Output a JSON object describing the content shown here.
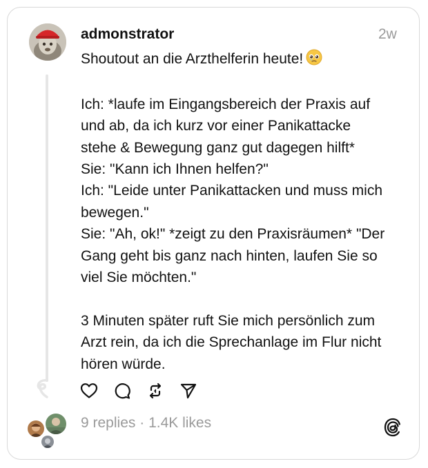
{
  "post": {
    "username": "admonstrator",
    "timestamp": "2w",
    "body_lines": [
      "Shoutout an die Arzthelferin heute!",
      "",
      "Ich: *laufe im Eingangsbereich der Praxis auf",
      "und ab, da ich kurz vor einer Panikattacke",
      "stehe & Bewegung ganz gut dagegen hilft*",
      "Sie: \"Kann ich Ihnen helfen?\"",
      "Ich: \"Leide unter Panikattacken und muss mich",
      "bewegen.\"",
      "Sie: \"Ah, ok!\" *zeigt zu den Praxisräumen* \"Der",
      "Gang geht bis ganz nach hinten, laufen Sie so",
      "viel Sie möchten.\"",
      "",
      "3 Minuten später ruft Sie mich persönlich zum",
      "Arzt rein, da ich die Sprechanlage im Flur nicht",
      "hören würde."
    ],
    "emoji": "🥹"
  },
  "actions": {
    "like_icon": "heart-icon",
    "reply_icon": "comment-icon",
    "repost_icon": "repost-icon",
    "share_icon": "send-icon"
  },
  "stats": {
    "replies": "9 replies",
    "separator": " · ",
    "likes": "1.4K likes"
  },
  "colors": {
    "text": "#111111",
    "muted": "#9a9a9a",
    "border": "#d8d8d8",
    "thread_line": "#e6e6e6"
  }
}
